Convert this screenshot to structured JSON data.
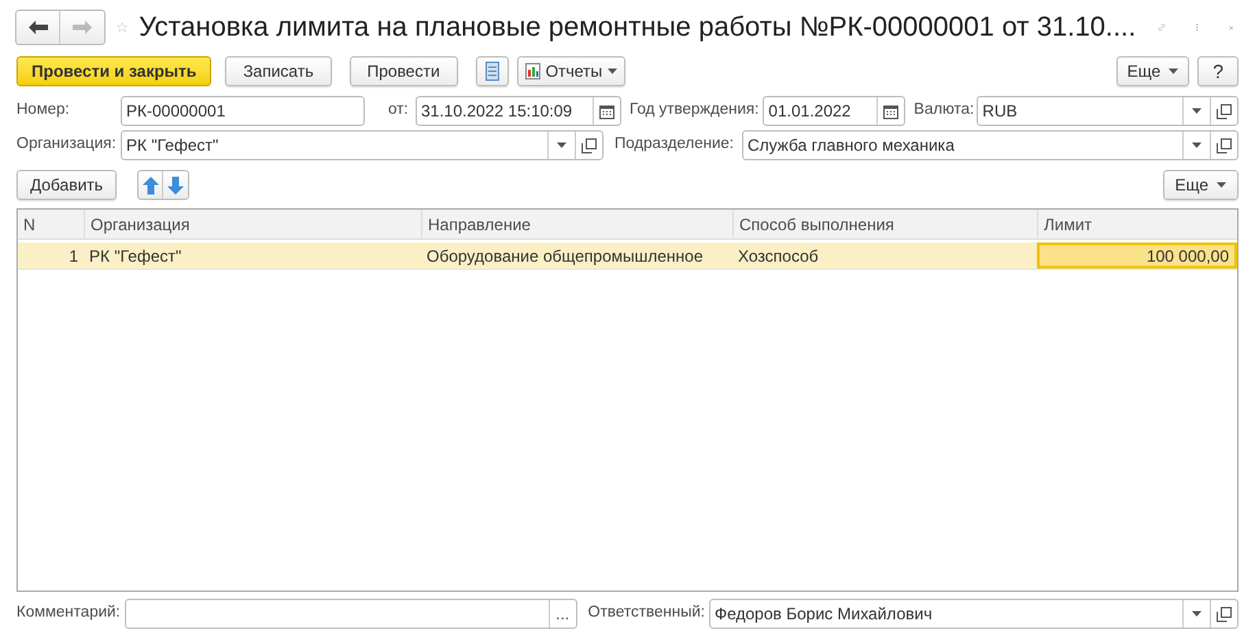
{
  "window": {
    "title": "Установка лимита на плановые ремонтные работы №РК-00000001 от 31.10....",
    "favorite": false,
    "back_enabled": true,
    "forward_enabled": false
  },
  "toolbar": {
    "buttons": [
      {
        "label": "Провести и закрыть",
        "kind": "primary"
      },
      {
        "label": "Записать",
        "kind": "normal"
      },
      {
        "label": "Провести",
        "kind": "normal"
      }
    ],
    "reports": "Отчеты",
    "more": "Еще",
    "help": "?"
  },
  "header_fields": {
    "number": {
      "label": "Номер:",
      "value": "РК-00000001"
    },
    "date": {
      "label": "от:",
      "value": "31.10.2022 15:10:09"
    },
    "year": {
      "label": "Год утверждения:",
      "value": "01.01.2022"
    },
    "currency": {
      "label": "Валюта:",
      "value": "RUB"
    },
    "organization": {
      "label": "Организация:",
      "value": "РК \"Гефест\""
    },
    "department": {
      "label": "Подразделение:",
      "value": "Служба главного механика"
    }
  },
  "table_toolbar": {
    "add": "Добавить",
    "more": "Еще"
  },
  "table": {
    "columns": [
      {
        "label": "N",
        "kind": "number"
      },
      {
        "label": "Организация",
        "kind": "text"
      },
      {
        "label": "Направление",
        "kind": "text"
      },
      {
        "label": "Способ выполнения",
        "kind": "text"
      },
      {
        "label": "Лимит",
        "kind": "number"
      }
    ],
    "rows": [
      {
        "selected": true,
        "cells": [
          {
            "text": "1",
            "focused": false
          },
          {
            "text": "РК \"Гефест\"",
            "focused": false
          },
          {
            "text": "Оборудование общепромышленное",
            "focused": false
          },
          {
            "text": "Хозспособ",
            "focused": false
          },
          {
            "text": "100 000,00",
            "focused": true
          }
        ]
      }
    ]
  },
  "footer": {
    "comment": {
      "label": "Комментарий:",
      "button": "..."
    },
    "responsible": {
      "label": "Ответственный:",
      "value": "Федоров Борис Михайлович"
    }
  }
}
